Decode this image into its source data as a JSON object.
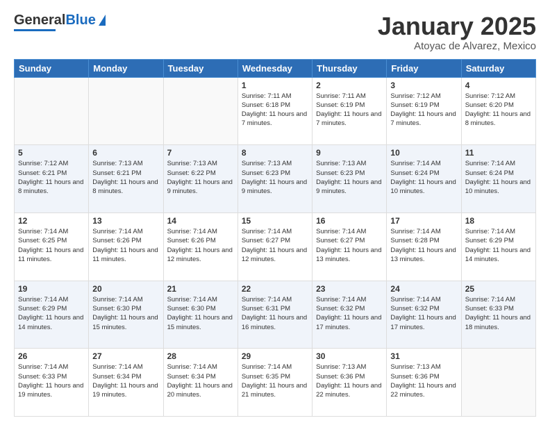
{
  "header": {
    "logo_general": "General",
    "logo_blue": "Blue",
    "title": "January 2025",
    "location": "Atoyac de Alvarez, Mexico"
  },
  "weekdays": [
    "Sunday",
    "Monday",
    "Tuesday",
    "Wednesday",
    "Thursday",
    "Friday",
    "Saturday"
  ],
  "weeks": [
    [
      {
        "day": "",
        "info": ""
      },
      {
        "day": "",
        "info": ""
      },
      {
        "day": "",
        "info": ""
      },
      {
        "day": "1",
        "info": "Sunrise: 7:11 AM\nSunset: 6:18 PM\nDaylight: 11 hours and 7 minutes."
      },
      {
        "day": "2",
        "info": "Sunrise: 7:11 AM\nSunset: 6:19 PM\nDaylight: 11 hours and 7 minutes."
      },
      {
        "day": "3",
        "info": "Sunrise: 7:12 AM\nSunset: 6:19 PM\nDaylight: 11 hours and 7 minutes."
      },
      {
        "day": "4",
        "info": "Sunrise: 7:12 AM\nSunset: 6:20 PM\nDaylight: 11 hours and 8 minutes."
      }
    ],
    [
      {
        "day": "5",
        "info": "Sunrise: 7:12 AM\nSunset: 6:21 PM\nDaylight: 11 hours and 8 minutes."
      },
      {
        "day": "6",
        "info": "Sunrise: 7:13 AM\nSunset: 6:21 PM\nDaylight: 11 hours and 8 minutes."
      },
      {
        "day": "7",
        "info": "Sunrise: 7:13 AM\nSunset: 6:22 PM\nDaylight: 11 hours and 9 minutes."
      },
      {
        "day": "8",
        "info": "Sunrise: 7:13 AM\nSunset: 6:23 PM\nDaylight: 11 hours and 9 minutes."
      },
      {
        "day": "9",
        "info": "Sunrise: 7:13 AM\nSunset: 6:23 PM\nDaylight: 11 hours and 9 minutes."
      },
      {
        "day": "10",
        "info": "Sunrise: 7:14 AM\nSunset: 6:24 PM\nDaylight: 11 hours and 10 minutes."
      },
      {
        "day": "11",
        "info": "Sunrise: 7:14 AM\nSunset: 6:24 PM\nDaylight: 11 hours and 10 minutes."
      }
    ],
    [
      {
        "day": "12",
        "info": "Sunrise: 7:14 AM\nSunset: 6:25 PM\nDaylight: 11 hours and 11 minutes."
      },
      {
        "day": "13",
        "info": "Sunrise: 7:14 AM\nSunset: 6:26 PM\nDaylight: 11 hours and 11 minutes."
      },
      {
        "day": "14",
        "info": "Sunrise: 7:14 AM\nSunset: 6:26 PM\nDaylight: 11 hours and 12 minutes."
      },
      {
        "day": "15",
        "info": "Sunrise: 7:14 AM\nSunset: 6:27 PM\nDaylight: 11 hours and 12 minutes."
      },
      {
        "day": "16",
        "info": "Sunrise: 7:14 AM\nSunset: 6:27 PM\nDaylight: 11 hours and 13 minutes."
      },
      {
        "day": "17",
        "info": "Sunrise: 7:14 AM\nSunset: 6:28 PM\nDaylight: 11 hours and 13 minutes."
      },
      {
        "day": "18",
        "info": "Sunrise: 7:14 AM\nSunset: 6:29 PM\nDaylight: 11 hours and 14 minutes."
      }
    ],
    [
      {
        "day": "19",
        "info": "Sunrise: 7:14 AM\nSunset: 6:29 PM\nDaylight: 11 hours and 14 minutes."
      },
      {
        "day": "20",
        "info": "Sunrise: 7:14 AM\nSunset: 6:30 PM\nDaylight: 11 hours and 15 minutes."
      },
      {
        "day": "21",
        "info": "Sunrise: 7:14 AM\nSunset: 6:30 PM\nDaylight: 11 hours and 15 minutes."
      },
      {
        "day": "22",
        "info": "Sunrise: 7:14 AM\nSunset: 6:31 PM\nDaylight: 11 hours and 16 minutes."
      },
      {
        "day": "23",
        "info": "Sunrise: 7:14 AM\nSunset: 6:32 PM\nDaylight: 11 hours and 17 minutes."
      },
      {
        "day": "24",
        "info": "Sunrise: 7:14 AM\nSunset: 6:32 PM\nDaylight: 11 hours and 17 minutes."
      },
      {
        "day": "25",
        "info": "Sunrise: 7:14 AM\nSunset: 6:33 PM\nDaylight: 11 hours and 18 minutes."
      }
    ],
    [
      {
        "day": "26",
        "info": "Sunrise: 7:14 AM\nSunset: 6:33 PM\nDaylight: 11 hours and 19 minutes."
      },
      {
        "day": "27",
        "info": "Sunrise: 7:14 AM\nSunset: 6:34 PM\nDaylight: 11 hours and 19 minutes."
      },
      {
        "day": "28",
        "info": "Sunrise: 7:14 AM\nSunset: 6:34 PM\nDaylight: 11 hours and 20 minutes."
      },
      {
        "day": "29",
        "info": "Sunrise: 7:14 AM\nSunset: 6:35 PM\nDaylight: 11 hours and 21 minutes."
      },
      {
        "day": "30",
        "info": "Sunrise: 7:13 AM\nSunset: 6:36 PM\nDaylight: 11 hours and 22 minutes."
      },
      {
        "day": "31",
        "info": "Sunrise: 7:13 AM\nSunset: 6:36 PM\nDaylight: 11 hours and 22 minutes."
      },
      {
        "day": "",
        "info": ""
      }
    ]
  ]
}
